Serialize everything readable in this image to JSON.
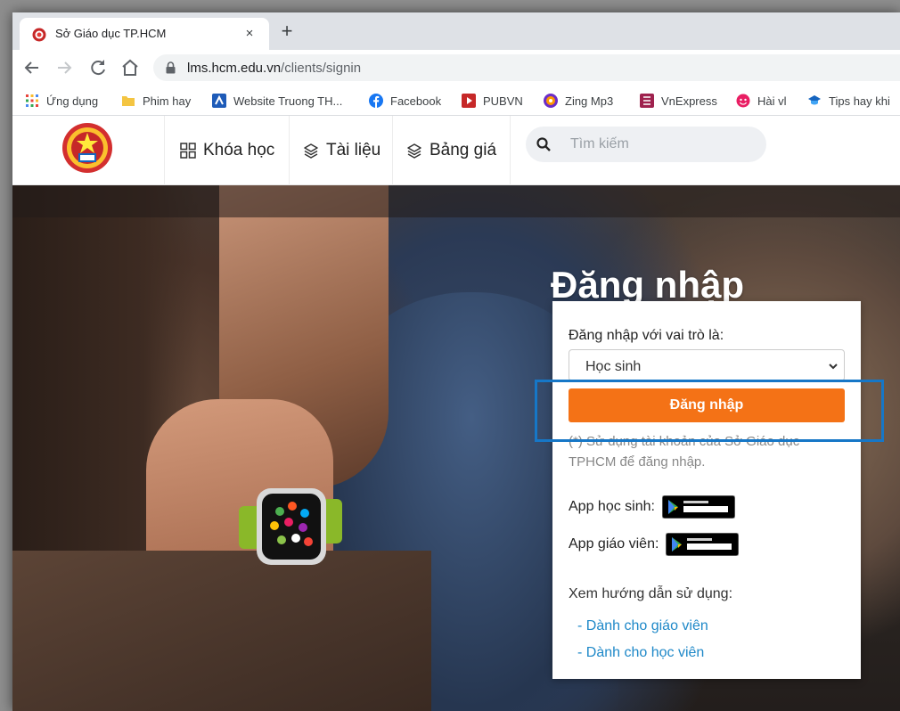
{
  "browser": {
    "tab_title": "Sở Giáo dục TP.HCM",
    "tab_close": "×",
    "new_tab": "+",
    "url_host": "lms.hcm.edu.vn",
    "url_path": "/clients/signin"
  },
  "bookmarks": [
    {
      "label": "Ứng dụng",
      "icon": "apps-grid-icon"
    },
    {
      "label": "Phim hay",
      "icon": "folder-icon"
    },
    {
      "label": "Website Truong TH...",
      "icon": "website-icon"
    },
    {
      "label": "Facebook",
      "icon": "facebook-icon"
    },
    {
      "label": "PUBVN",
      "icon": "pubvn-icon"
    },
    {
      "label": "Zing Mp3",
      "icon": "zingmp3-icon"
    },
    {
      "label": "VnExpress",
      "icon": "vnexpress-icon"
    },
    {
      "label": "Hài vl",
      "icon": "haivl-icon"
    },
    {
      "label": "Tips hay khi",
      "icon": "tips-icon"
    }
  ],
  "site_nav": {
    "courses": "Khóa học",
    "documents": "Tài liệu",
    "pricing": "Bảng giá",
    "search_placeholder": "Tìm kiếm"
  },
  "login": {
    "title": "Đăng nhập",
    "role_label": "Đăng nhập với vai trò là:",
    "role_value": "Học sinh",
    "button": "Đăng nhập",
    "note": "(*) Sử dụng tài khoản của Sở Giáo dục TPHCM để đăng nhập.",
    "app_student": "App học sinh:",
    "app_teacher": "App giáo viên:",
    "guide_heading": "Xem hướng dẫn sử dụng:",
    "guide_teacher": "- Dành cho giáo viên",
    "guide_student": "- Dành cho học viên"
  },
  "colors": {
    "login_button": "#f47216",
    "highlight_box": "#1677c7",
    "link": "#1e88c8"
  }
}
